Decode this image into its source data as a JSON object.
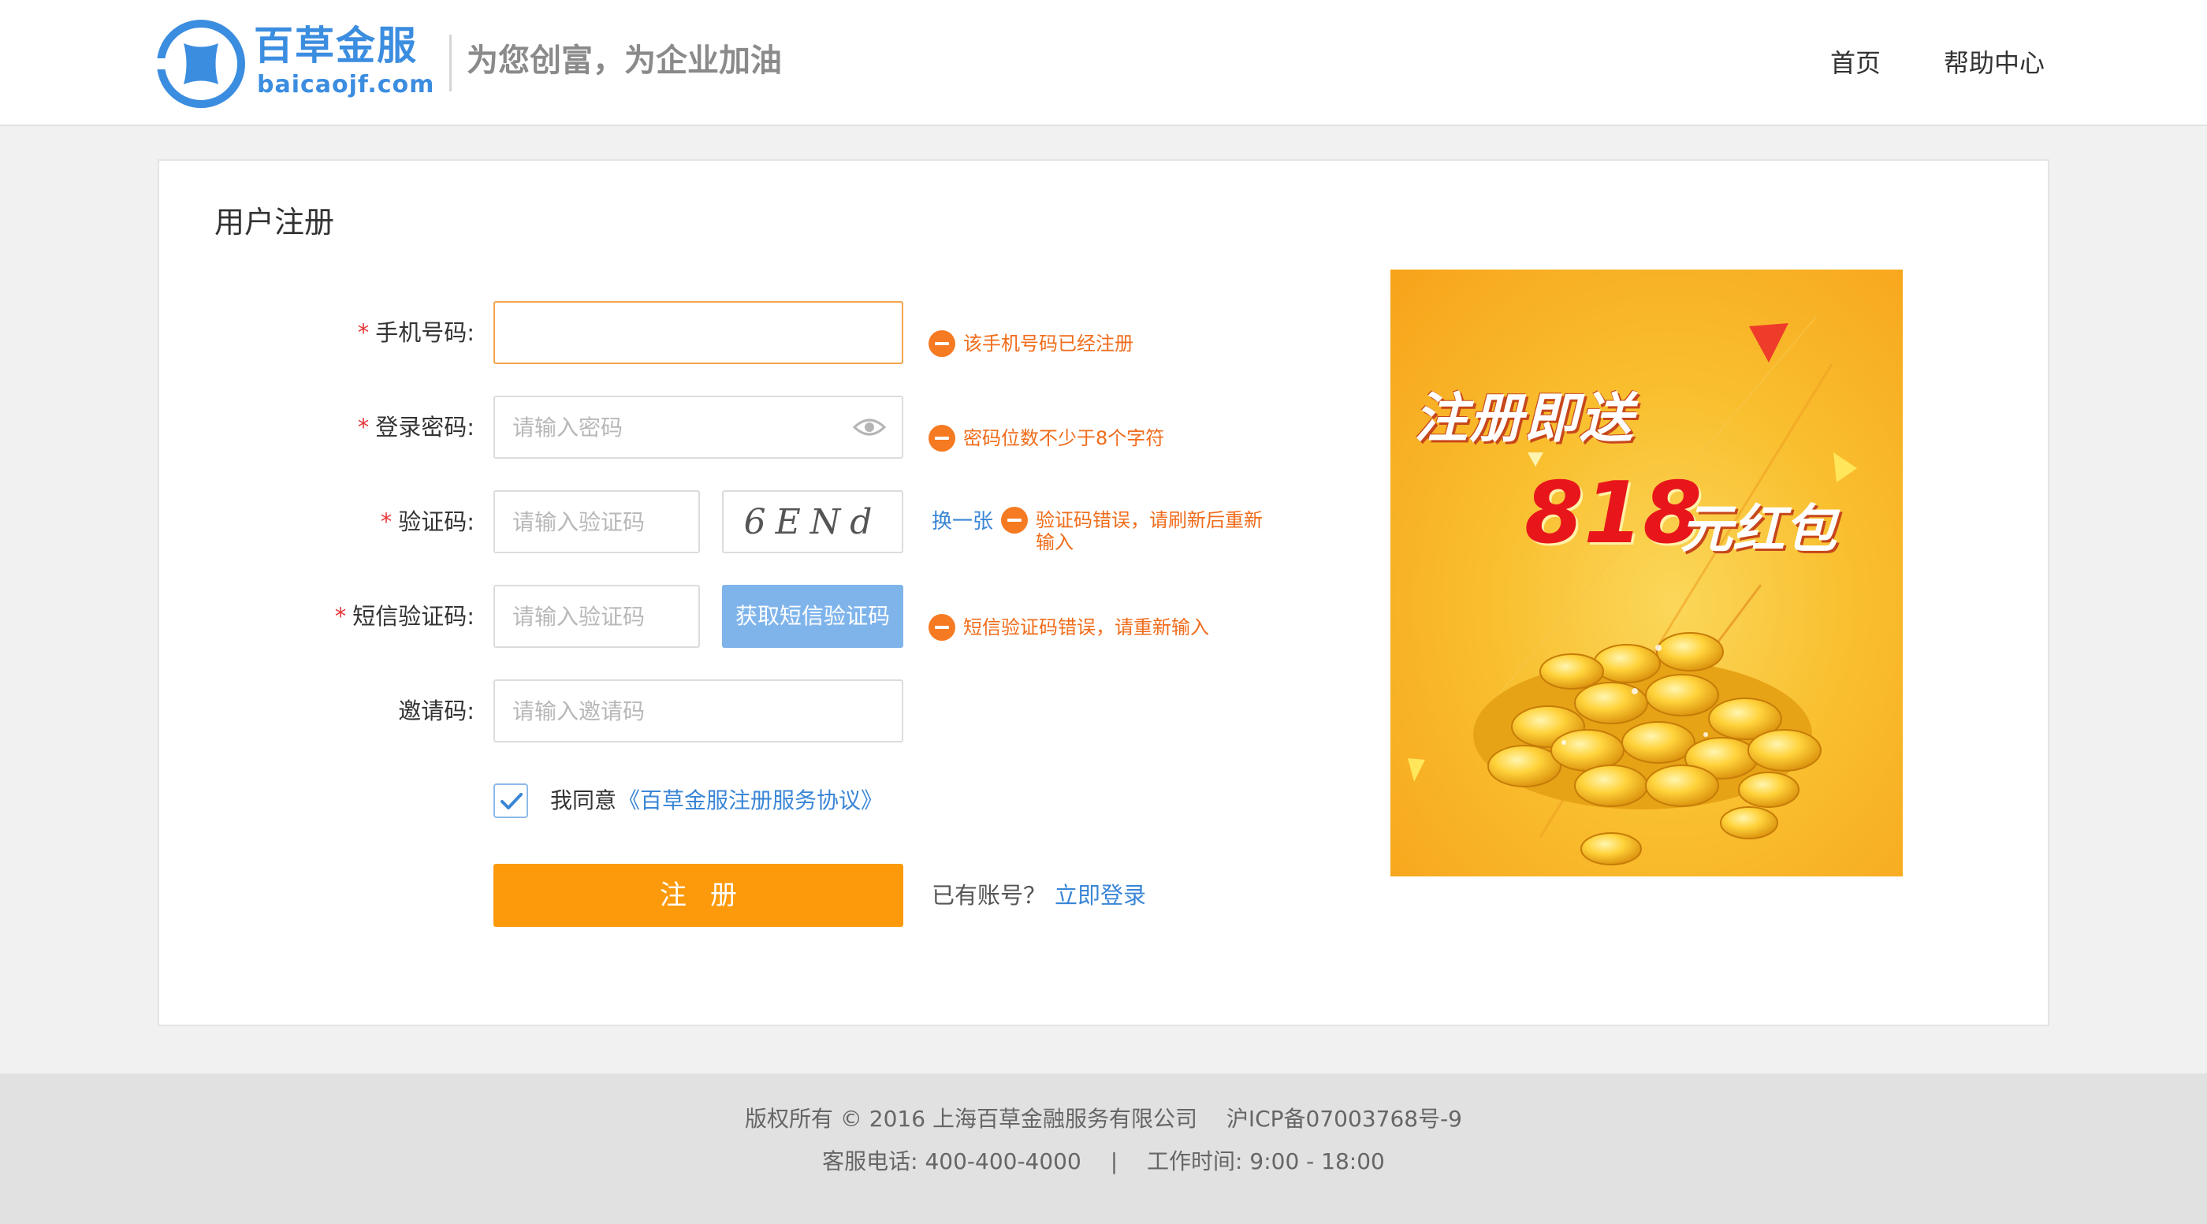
{
  "header": {
    "brand_cn": "百草金服",
    "brand_en": "baicaojf.com",
    "slogan": "为您创富，为企业加油",
    "nav": {
      "home": "首页",
      "help": "帮助中心"
    }
  },
  "form": {
    "title": "用户注册",
    "required_mark": "*",
    "phone": {
      "label": "手机号码:",
      "value": "",
      "placeholder": "",
      "error": "该手机号码已经注册"
    },
    "password": {
      "label": "登录密码:",
      "placeholder": "请输入密码",
      "error": "密码位数不少于8个字符"
    },
    "captcha": {
      "label": "验证码:",
      "placeholder": "请输入验证码",
      "image_text": "6ENd",
      "refresh": "换一张",
      "error": "验证码错误，请刷新后重新输入"
    },
    "sms": {
      "label": "短信验证码:",
      "placeholder": "请输入验证码",
      "button": "获取短信验证码",
      "error": "短信验证码错误，请重新输入"
    },
    "invite": {
      "label": "邀请码:",
      "placeholder": "请输入邀请码"
    },
    "agree": {
      "checked": true,
      "text": "我同意",
      "link": "《百草金服注册服务协议》"
    },
    "submit": "注册",
    "have_account": "已有账号？",
    "login_link": "立即登录"
  },
  "banner": {
    "line1": "注册即送",
    "amount": "818",
    "unit": "元红包"
  },
  "footer": {
    "line1": "版权所有 © 2016 上海百草金融服务有限公司　 沪ICP备07003768号-9",
    "line2": "客服电话:  400-400-4000　 |　 工作时间:  9:00 - 18:00"
  },
  "colors": {
    "brand_blue": "#3b8de0",
    "accent_orange": "#fc9a0c",
    "error_orange": "#f06c1b",
    "link_blue": "#3a86d6",
    "sms_button": "#7fb4eb"
  },
  "icons": [
    "logo-icon",
    "eye-icon",
    "error-icon",
    "checkmark-icon",
    "coins-illustration"
  ]
}
